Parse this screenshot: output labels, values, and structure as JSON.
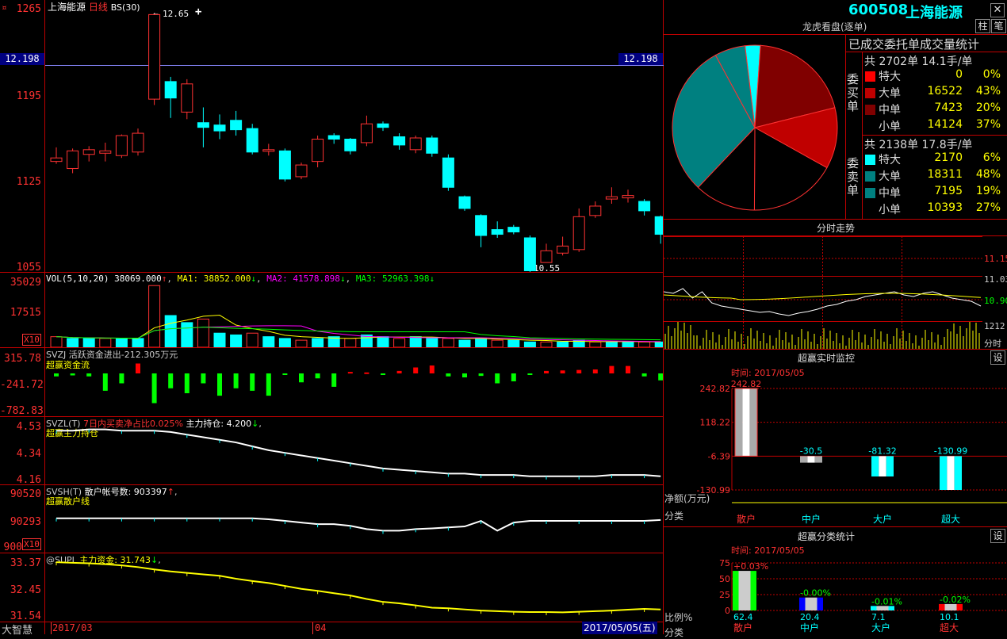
{
  "stock": {
    "code": "600508",
    "name": "上海能源",
    "close_icon": "close-icon"
  },
  "kline": {
    "title_name": "上海能源",
    "title_period": "日线",
    "title_bs": "BS(30)",
    "price_tag": "12.198",
    "high_note": "12.65",
    "low_note": "10.55",
    "y_labels": [
      "1265",
      "1195",
      "1125",
      "1055"
    ],
    "plus_mark": "+",
    "candles": [
      {
        "o": 11.4,
        "c": 11.43,
        "h": 11.52,
        "l": 11.38
      },
      {
        "o": 11.34,
        "c": 11.49,
        "h": 11.51,
        "l": 11.3
      },
      {
        "o": 11.46,
        "c": 11.5,
        "h": 11.53,
        "l": 11.4
      },
      {
        "o": 11.47,
        "c": 11.49,
        "h": 11.56,
        "l": 11.4
      },
      {
        "o": 11.45,
        "c": 11.62,
        "h": 11.63,
        "l": 11.43
      },
      {
        "o": 11.48,
        "c": 11.64,
        "h": 11.68,
        "l": 11.45
      },
      {
        "o": 11.93,
        "c": 12.65,
        "h": 12.65,
        "l": 11.88
      },
      {
        "o": 12.08,
        "c": 11.94,
        "h": 12.12,
        "l": 11.77
      },
      {
        "o": 11.82,
        "c": 12.06,
        "h": 12.1,
        "l": 11.76
      },
      {
        "o": 11.73,
        "c": 11.69,
        "h": 11.86,
        "l": 11.52
      },
      {
        "o": 11.71,
        "c": 11.66,
        "h": 11.8,
        "l": 11.59
      },
      {
        "o": 11.75,
        "c": 11.67,
        "h": 11.83,
        "l": 11.62
      },
      {
        "o": 11.68,
        "c": 11.48,
        "h": 11.72,
        "l": 11.46
      },
      {
        "o": 11.5,
        "c": 11.5,
        "h": 11.55,
        "l": 11.45
      },
      {
        "o": 11.49,
        "c": 11.25,
        "h": 11.51,
        "l": 11.23
      },
      {
        "o": 11.27,
        "c": 11.37,
        "h": 11.39,
        "l": 11.25
      },
      {
        "o": 11.4,
        "c": 11.59,
        "h": 11.62,
        "l": 11.35
      },
      {
        "o": 11.62,
        "c": 11.59,
        "h": 11.64,
        "l": 11.55
      },
      {
        "o": 11.59,
        "c": 11.49,
        "h": 11.6,
        "l": 11.46
      },
      {
        "o": 11.56,
        "c": 11.72,
        "h": 11.79,
        "l": 11.53
      },
      {
        "o": 11.72,
        "c": 11.69,
        "h": 11.74,
        "l": 11.66
      },
      {
        "o": 11.61,
        "c": 11.54,
        "h": 11.64,
        "l": 11.5
      },
      {
        "o": 11.5,
        "c": 11.6,
        "h": 11.62,
        "l": 11.47
      },
      {
        "o": 11.6,
        "c": 11.47,
        "h": 11.62,
        "l": 11.44
      },
      {
        "o": 11.43,
        "c": 11.18,
        "h": 11.46,
        "l": 11.15
      },
      {
        "o": 11.1,
        "c": 11.0,
        "h": 11.11,
        "l": 10.98
      },
      {
        "o": 10.94,
        "c": 10.77,
        "h": 10.95,
        "l": 10.67
      },
      {
        "o": 10.82,
        "c": 10.78,
        "h": 10.89,
        "l": 10.75
      },
      {
        "o": 10.84,
        "c": 10.8,
        "h": 10.86,
        "l": 10.78
      },
      {
        "o": 10.75,
        "c": 10.47,
        "h": 10.77,
        "l": 10.44
      },
      {
        "o": 10.54,
        "c": 10.64,
        "h": 10.7,
        "l": 10.55
      },
      {
        "o": 10.62,
        "c": 10.68,
        "h": 10.76,
        "l": 10.6
      },
      {
        "o": 10.65,
        "c": 10.93,
        "h": 11.0,
        "l": 10.63
      },
      {
        "o": 10.94,
        "c": 11.02,
        "h": 11.06,
        "l": 10.92
      },
      {
        "o": 11.08,
        "c": 11.1,
        "h": 11.18,
        "l": 11.04
      },
      {
        "o": 11.09,
        "c": 11.11,
        "h": 11.16,
        "l": 11.05
      },
      {
        "o": 11.06,
        "c": 10.98,
        "h": 11.08,
        "l": 10.94
      },
      {
        "o": 10.93,
        "c": 10.78,
        "h": 10.94,
        "l": 10.7
      }
    ]
  },
  "vol": {
    "title": "VOL(5,10,20)",
    "val": "38069.000",
    "ma1_label": "MA1:",
    "ma1": "38852.000",
    "ma2_label": "MA2:",
    "ma2": "41578.898",
    "ma3_label": "MA3:",
    "ma3": "52963.398",
    "y_labels": [
      "35029",
      "17515"
    ],
    "unit": "X10",
    "bars": [
      6,
      5,
      5,
      5,
      5,
      5,
      35,
      18,
      14,
      16,
      8,
      7,
      8,
      6,
      5,
      4,
      5,
      6,
      5,
      7,
      6,
      5,
      6,
      5,
      5,
      4,
      5,
      4,
      4,
      3,
      3,
      3,
      4,
      3,
      3,
      3,
      3,
      3
    ]
  },
  "svzj": {
    "title": "SVZJ 活跃资金进出-212.305万元",
    "subtitle": "超赢资金流",
    "y_labels": [
      "315.78",
      "-241.72",
      "-782.83"
    ],
    "bars": [
      -60,
      -40,
      -60,
      -350,
      -200,
      200,
      -600,
      -300,
      -400,
      -200,
      -450,
      -300,
      -350,
      -450,
      -30,
      -180,
      -100,
      -270,
      30,
      20,
      -30,
      50,
      120,
      160,
      -60,
      -80,
      -50,
      -200,
      -160,
      -20,
      50,
      60,
      70,
      80,
      150,
      150,
      -60,
      -140
    ]
  },
  "svzl": {
    "title": "SVZL(T)",
    "desc": "7日内买卖净占比0.025%",
    "hold_label": "主力持仓:",
    "hold": "4.200",
    "subtitle": "超赢主力持仓",
    "y_labels": [
      "4.53",
      "4.34",
      "4.16"
    ],
    "line": [
      4.53,
      4.53,
      4.54,
      4.54,
      4.53,
      4.53,
      4.53,
      4.52,
      4.5,
      4.48,
      4.46,
      4.44,
      4.41,
      4.38,
      4.36,
      4.34,
      4.32,
      4.3,
      4.28,
      4.26,
      4.24,
      4.23,
      4.22,
      4.21,
      4.2,
      4.2,
      4.19,
      4.19,
      4.19,
      4.18,
      4.18,
      4.18,
      4.18,
      4.18,
      4.19,
      4.19,
      4.19,
      4.18
    ]
  },
  "svsh": {
    "title": "SVSH(T)",
    "desc": "散户帐号数:",
    "value": "903397",
    "subtitle": "超赢散户线",
    "y_labels": [
      "90520",
      "90293",
      "900"
    ],
    "unit": "X10",
    "line": [
      90293,
      90293,
      90293,
      90293,
      90293,
      90293,
      90293,
      90293,
      90293,
      90293,
      90293,
      90293,
      90293,
      90290,
      90285,
      90280,
      90275,
      90275,
      90270,
      90260,
      90255,
      90255,
      90260,
      90262,
      90265,
      90268,
      90285,
      90255,
      90280,
      90285,
      90285,
      90285,
      90285,
      90285,
      90285,
      90285,
      90285,
      90288
    ]
  },
  "supl": {
    "title": "@SUPL",
    "label": "主力资金:",
    "value": "31.743",
    "y_labels": [
      "33.37",
      "32.45",
      "31.54"
    ],
    "line": [
      33.37,
      33.35,
      33.33,
      33.3,
      33.26,
      33.2,
      33.12,
      33.05,
      33.0,
      32.95,
      32.9,
      32.8,
      32.72,
      32.65,
      32.55,
      32.45,
      32.38,
      32.3,
      32.22,
      32.1,
      32.0,
      31.95,
      31.88,
      31.8,
      31.78,
      31.74,
      31.7,
      31.68,
      31.66,
      31.65,
      31.65,
      31.64,
      31.66,
      31.68,
      31.7,
      31.73,
      31.76,
      31.74
    ]
  },
  "xaxis": {
    "brand": "大智慧",
    "start": "2017/03",
    "mid": "04",
    "end": "2017/05/05(五)"
  },
  "right": {
    "btn_pin": "柱",
    "btn_pen": "笔",
    "longhu_title": "龙虎看盘(逐单)",
    "stats_title": "已成交委托单成交量统计",
    "buy": {
      "side": "委买单",
      "summary": "共 2702单 14.1手/单",
      "rows": [
        {
          "name": "特大",
          "vol": "0",
          "pct": "0%",
          "color": "#ff0000"
        },
        {
          "name": "大单",
          "vol": "16522",
          "pct": "43%",
          "color": "#c00000"
        },
        {
          "name": "中单",
          "vol": "7423",
          "pct": "20%",
          "color": "#800000"
        },
        {
          "name": "小单",
          "vol": "14124",
          "pct": "37%",
          "color": "#000000"
        }
      ]
    },
    "sell": {
      "side": "委卖单",
      "summary": "共 2138单 17.8手/单",
      "rows": [
        {
          "name": "特大",
          "vol": "2170",
          "pct": "6%",
          "color": "#00ffff"
        },
        {
          "name": "大单",
          "vol": "18311",
          "pct": "48%",
          "color": "#008080"
        },
        {
          "name": "中单",
          "vol": "7195",
          "pct": "19%",
          "color": "#008080"
        },
        {
          "name": "小单",
          "vol": "10393",
          "pct": "27%",
          "color": "#000000"
        }
      ]
    },
    "intraday": {
      "title": "分时走势",
      "y_labels": [
        "11.15",
        "11.03",
        "10.90"
      ],
      "vol_label": "1212",
      "fen": "分时"
    },
    "monitor": {
      "title": "超赢实时监控",
      "btn": "设",
      "time": "时间: 2017/05/05",
      "y_labels": [
        "242.82",
        "118.22",
        "-6.39",
        "-130.99"
      ],
      "axis_label": "净额(万元)",
      "cat_label": "分类",
      "cats": [
        "散户",
        "中户",
        "大户",
        "超大"
      ],
      "values": [
        242.82,
        -30.5,
        -81.32,
        -130.99
      ],
      "value_labels": [
        "242.82",
        "-30.5",
        "-81.32",
        "-130.99"
      ]
    },
    "classify": {
      "title": "超赢分类统计",
      "btn": "设",
      "time": "时间: 2017/05/05",
      "y_labels": [
        "75",
        "50",
        "25",
        "0"
      ],
      "axis_label": "比例%",
      "cat_label": "分类",
      "cats": [
        "散户",
        "中户",
        "大户",
        "超大"
      ],
      "pct_labels": [
        "+0.03%",
        "-0.00%",
        "-0.01%",
        "-0.02%"
      ],
      "values": [
        62.4,
        20.4,
        7.1,
        10.1
      ],
      "value_labels": [
        "62.4",
        "20.4",
        "7.1",
        "10.1"
      ]
    }
  }
}
